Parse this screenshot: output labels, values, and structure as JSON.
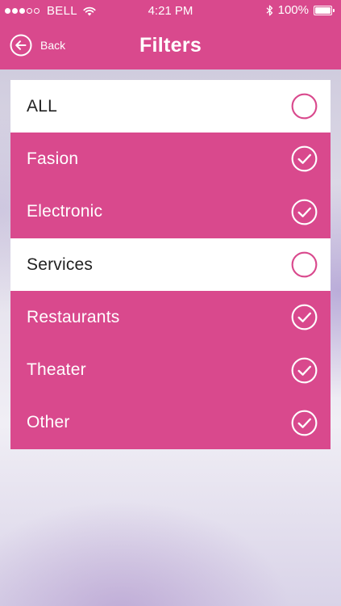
{
  "status_bar": {
    "carrier": "BELL",
    "time": "4:21 PM",
    "battery": "100%",
    "signal_bars_filled": 3,
    "signal_bars_total": 5
  },
  "header": {
    "back_label": "Back",
    "title": "Filters"
  },
  "filters": [
    {
      "label": "ALL",
      "checked": false
    },
    {
      "label": "Fasion",
      "checked": true
    },
    {
      "label": "Electronic",
      "checked": true
    },
    {
      "label": "Services",
      "checked": false
    },
    {
      "label": "Restaurants",
      "checked": true
    },
    {
      "label": "Theater",
      "checked": true
    },
    {
      "label": "Other",
      "checked": true
    }
  ],
  "colors": {
    "accent": "#d9498d",
    "unchecked_background": "#ffffff",
    "unchecked_text": "#222222"
  },
  "icons": {
    "back": "arrow-left-circle-icon",
    "checked": "checkmark-circle-icon",
    "unchecked": "empty-circle-icon"
  }
}
